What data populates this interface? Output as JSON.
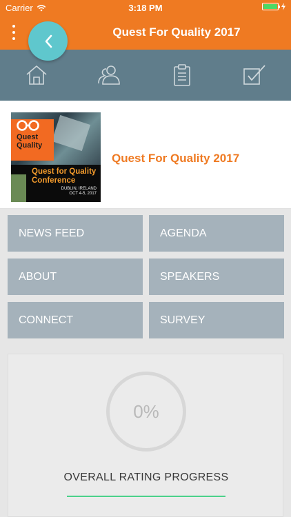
{
  "status": {
    "carrier": "Carrier",
    "time": "3:18 PM"
  },
  "nav": {
    "title": "Quest For Quality 2017"
  },
  "tabs": [
    {
      "icon": "home-icon"
    },
    {
      "icon": "people-icon"
    },
    {
      "icon": "clipboard-icon"
    },
    {
      "icon": "checkbox-icon"
    }
  ],
  "event": {
    "title": "Quest For Quality 2017",
    "image": {
      "line1": "Quest",
      "line2": "Quality",
      "conference": "Quest for Quality Conference",
      "place": "DUBLIN, IRELAND",
      "dates": "OCT 4-5, 2017"
    }
  },
  "menu": {
    "news_feed": "NEWS FEED",
    "agenda": "AGENDA",
    "about": "ABOUT",
    "speakers": "SPEAKERS",
    "connect": "CONNECT",
    "survey": "SURVEY"
  },
  "rating": {
    "percent": "0%",
    "label": "OVERALL RATING PROGRESS",
    "progress_fraction": 0
  },
  "colors": {
    "accent": "#ef7a22",
    "tabbar": "#607d8b",
    "back": "#5fc7cd",
    "tile": "#a5b2bb",
    "progress": "#4bd18a"
  }
}
